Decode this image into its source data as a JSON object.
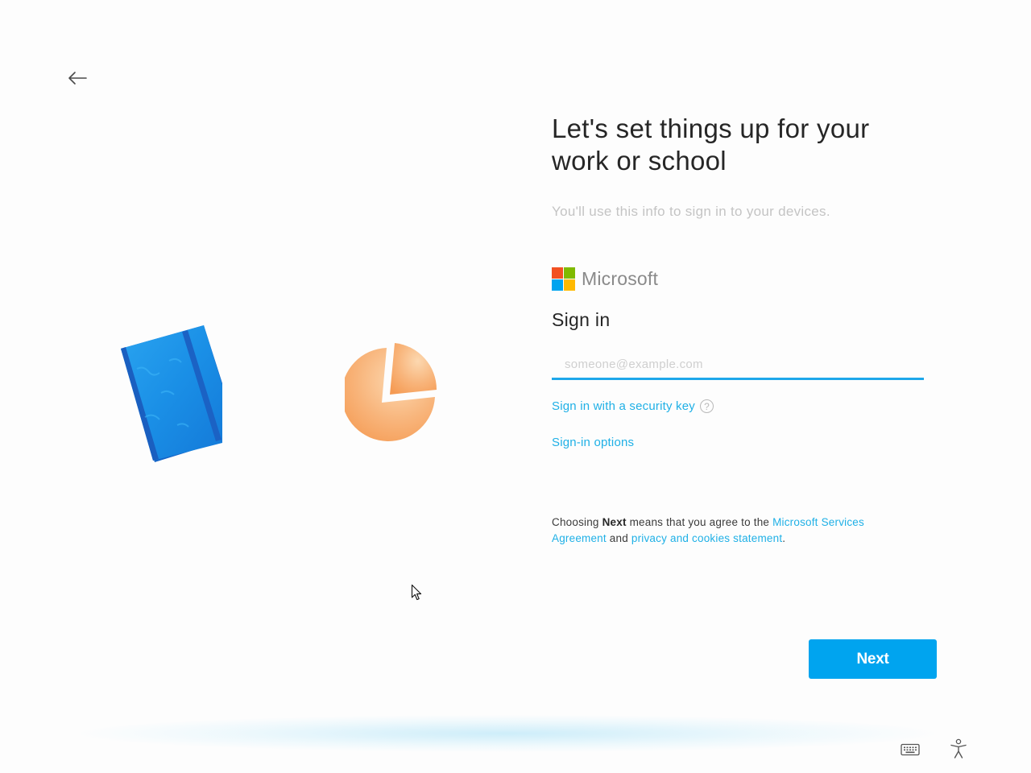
{
  "header": {
    "back_icon": "arrow-left-icon"
  },
  "illustrations": {
    "notebook_icon": "notebook-icon",
    "pie_icon": "pie-chart-icon",
    "notebook_color": "#1a8fe6",
    "pie_color": "#f7a35f"
  },
  "main": {
    "title": "Let's set things up for your work or school",
    "subtitle": "You'll use this info to sign in to your devices.",
    "brand_name": "Microsoft",
    "sign_in_heading": "Sign in",
    "email_placeholder": "someone@example.com",
    "email_value": "",
    "security_key_link": "Sign in with a security key",
    "help_icon": "question-circle-icon",
    "signin_options_link": "Sign-in options"
  },
  "agreement": {
    "prefix": "Choosing ",
    "bold": "Next",
    "middle": " means that you agree to the ",
    "link_services": "Microsoft Services Agreement",
    "and": " and ",
    "link_privacy": "privacy and cookies statement",
    "suffix": "."
  },
  "footer": {
    "next_label": "Next",
    "keyboard_icon": "keyboard-icon",
    "accessibility_icon": "accessibility-icon"
  },
  "colors": {
    "accent": "#00a4ef",
    "link": "#1fb0e6",
    "ms_red": "#f25022",
    "ms_green": "#7fba00",
    "ms_blue": "#00a4ef",
    "ms_yellow": "#ffb900"
  }
}
